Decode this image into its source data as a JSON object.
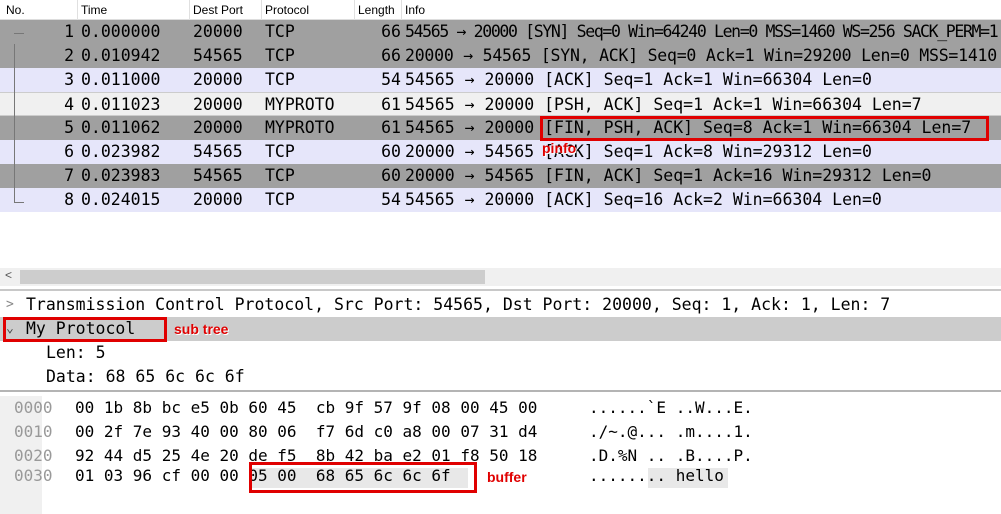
{
  "columns": [
    "No.",
    "Time",
    "Dest Port",
    "Protocol",
    "Length",
    "Info"
  ],
  "packets": [
    {
      "no": "1",
      "time": "0.000000",
      "dport": "20000",
      "proto": "TCP",
      "len": "66",
      "info": "54565 → 20000 [SYN] Seq=0 Win=64240 Len=0 MSS=1460 WS=256 SACK_PERM=1"
    },
    {
      "no": "2",
      "time": "0.010942",
      "dport": "54565",
      "proto": "TCP",
      "len": "66",
      "info": "20000 → 54565 [SYN, ACK] Seq=0 Ack=1 Win=29200 Len=0 MSS=1410"
    },
    {
      "no": "3",
      "time": "0.011000",
      "dport": "20000",
      "proto": "TCP",
      "len": "54",
      "info": "54565 → 20000 [ACK] Seq=1 Ack=1 Win=66304 Len=0"
    },
    {
      "no": "4",
      "time": "0.011023",
      "dport": "20000",
      "proto": "MYPROTO",
      "len": "61",
      "info": "54565 → 20000 [PSH, ACK] Seq=1 Ack=1 Win=66304 Len=7"
    },
    {
      "no": "5",
      "time": "0.011062",
      "dport": "20000",
      "proto": "MYPROTO",
      "len": "61",
      "info": "54565 → 20000 [FIN, PSH, ACK] Seq=8 Ack=1 Win=66304 Len=7"
    },
    {
      "no": "6",
      "time": "0.023982",
      "dport": "54565",
      "proto": "TCP",
      "len": "60",
      "info": "20000 → 54565 [ACK] Seq=1 Ack=8 Win=29312 Len=0"
    },
    {
      "no": "7",
      "time": "0.023983",
      "dport": "54565",
      "proto": "TCP",
      "len": "60",
      "info": "20000 → 54565 [FIN, ACK] Seq=1 Ack=16 Win=29312 Len=0"
    },
    {
      "no": "8",
      "time": "0.024015",
      "dport": "20000",
      "proto": "TCP",
      "len": "54",
      "info": "54565 → 20000 [ACK] Seq=16 Ack=2 Win=66304 Len=0"
    }
  ],
  "detail": {
    "tcp": "Transmission Control Protocol, Src Port: 54565, Dst Port: 20000, Seq: 1, Ack: 1, Len: 7",
    "myproto": "My Protocol",
    "len": "Len: 5",
    "data": "Data: 68 65 6c 6c 6f"
  },
  "hex": [
    {
      "off": "0000",
      "bytes": "00 1b 8b bc e5 0b 60 45  cb 9f 57 9f 08 00 45 00",
      "ascii": "......`E ..W...E."
    },
    {
      "off": "0010",
      "bytes": "00 2f 7e 93 40 00 80 06  f7 6d c0 a8 00 07 31 d4",
      "ascii": "./~.@... .m....1."
    },
    {
      "off": "0020",
      "bytes": "92 44 d5 25 4e 20 de f5  8b 42 ba e2 01 f8 50 18",
      "ascii": ".D.%N .. .B....P."
    },
    {
      "off": "0030",
      "bytes": "01 03 96 cf 00 00 05 00  68 65 6c 6c 6f",
      "ascii": "........ hello"
    }
  ],
  "annotations": {
    "pinfo": "pinfo",
    "subtree": "sub tree",
    "buffer": "buffer"
  },
  "colors": {
    "gray_row": "#a0a0a0",
    "lavender_row": "#e6e6fa",
    "selected_row": "#f0f0f0",
    "annotation": "#e00000"
  }
}
